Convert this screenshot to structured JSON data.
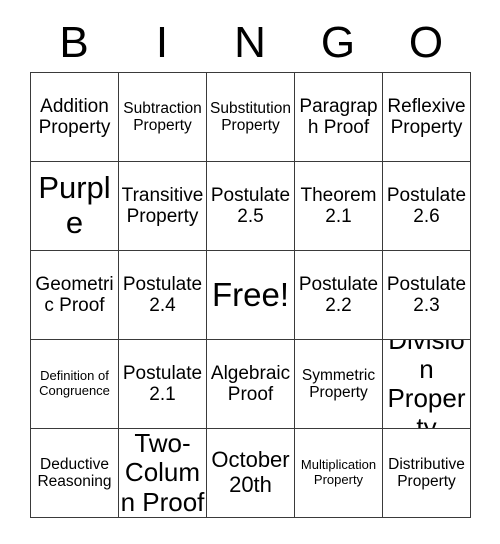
{
  "card": {
    "headers": [
      "B",
      "I",
      "N",
      "G",
      "O"
    ],
    "rows": [
      [
        {
          "text": "Addition Property",
          "size": "md"
        },
        {
          "text": "Subtraction Property",
          "size": "sm"
        },
        {
          "text": "Substitution Property",
          "size": "sm"
        },
        {
          "text": "Paragraph Proof",
          "size": "md"
        },
        {
          "text": "Reflexive Property",
          "size": "md"
        }
      ],
      [
        {
          "text": "Purple",
          "size": "xxl"
        },
        {
          "text": "Transitive Property",
          "size": "md"
        },
        {
          "text": "Postulate 2.5",
          "size": "md"
        },
        {
          "text": "Theorem 2.1",
          "size": "md"
        },
        {
          "text": "Postulate 2.6",
          "size": "md"
        }
      ],
      [
        {
          "text": "Geometric Proof",
          "size": "md"
        },
        {
          "text": "Postulate 2.4",
          "size": "md"
        },
        {
          "text": "Free!",
          "size": "free"
        },
        {
          "text": "Postulate 2.2",
          "size": "md"
        },
        {
          "text": "Postulate 2.3",
          "size": "md"
        }
      ],
      [
        {
          "text": "Definition of Congruence",
          "size": "xs"
        },
        {
          "text": "Postulate 2.1",
          "size": "md"
        },
        {
          "text": "Algebraic Proof",
          "size": "md"
        },
        {
          "text": "Symmetric Property",
          "size": "sm"
        },
        {
          "text": "Division Property",
          "size": "xl"
        }
      ],
      [
        {
          "text": "Deductive Reasoning",
          "size": "sm"
        },
        {
          "text": "Two-Column Proof",
          "size": "xl"
        },
        {
          "text": "October 20th",
          "size": "lg"
        },
        {
          "text": "Multiplication Property",
          "size": "xs"
        },
        {
          "text": "Distributive Property",
          "size": "sm"
        }
      ]
    ]
  }
}
